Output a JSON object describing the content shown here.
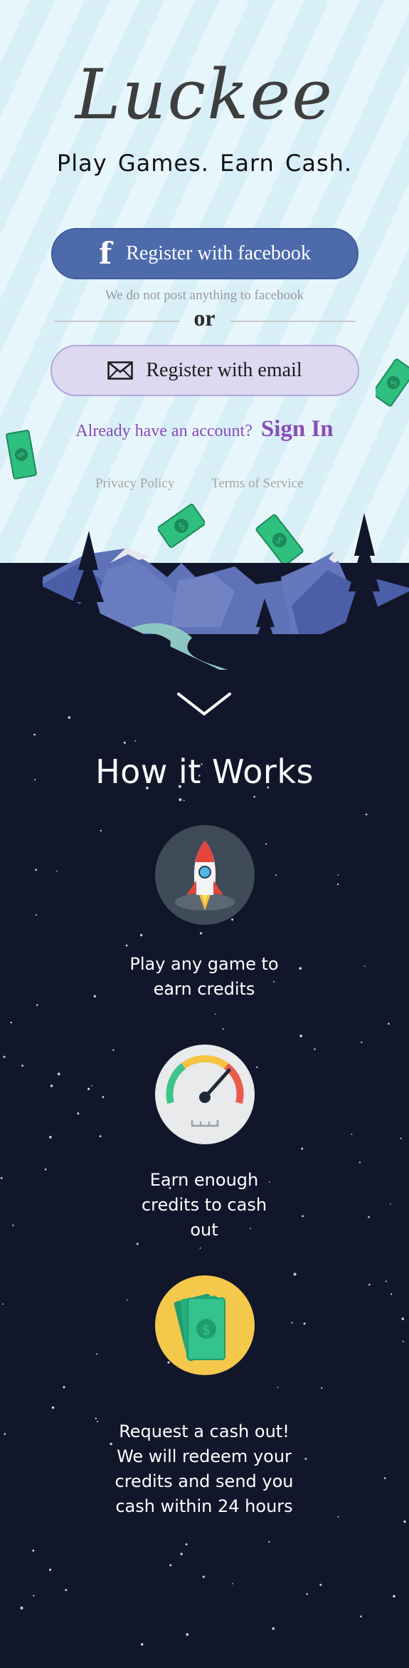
{
  "app": {
    "logo": "Luckee",
    "tagline": "Play Games.  Earn Cash."
  },
  "auth": {
    "facebook_icon": "facebook-f-icon",
    "facebook_label": "Register with facebook",
    "facebook_note": "We do not post anything to facebook",
    "or_label": "or",
    "email_icon": "envelope-icon",
    "email_label": "Register with email",
    "signin_prompt": "Already have an account?",
    "signin_link": "Sign In"
  },
  "legal": {
    "privacy": "Privacy Policy",
    "terms": "Terms of Service"
  },
  "scroll_icon": "chevron-down-icon",
  "how": {
    "title": "How it Works",
    "steps": [
      {
        "icon": "rocket-icon",
        "lines": [
          "Play any game to",
          "earn credits"
        ]
      },
      {
        "icon": "speedometer-icon",
        "lines": [
          "Earn enough",
          "credits to cash",
          "out"
        ]
      },
      {
        "icon": "money-icon",
        "lines": [
          "Request a cash out!",
          "We will redeem your",
          "credits  and send you",
          "cash within 24 hours"
        ]
      }
    ]
  },
  "colors": {
    "facebook_blue": "#4d6aab",
    "email_lavender": "#dcd9f0",
    "signin_purple": "#8a4cb6",
    "night": "#12162b",
    "money_green": "#2fbf7f"
  }
}
